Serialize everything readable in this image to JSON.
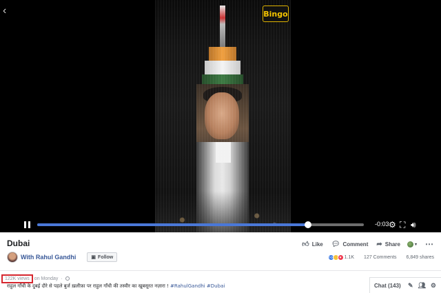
{
  "player": {
    "watermark": "Bingo",
    "time_remaining": "-0:03",
    "progress_fraction": 0.83
  },
  "post": {
    "title": "Dubai",
    "actions": {
      "like": "Like",
      "comment": "Comment",
      "share": "Share"
    },
    "page_name": "With Rahul Gandhi",
    "follow_label": "Follow",
    "reactions_count": "1.1K",
    "comments_count": "127 Comments",
    "shares_count": "6,849 shares",
    "views": "122K views",
    "posted": "on Monday",
    "caption": "राहुल गाँधी के दुबई दौरे से पहले बुर्ज ख़लीफ़ा पर राहुल गाँधी की तस्वीर का खूबसूरत नज़ारा !",
    "hashtags": "#RahulGandhi #Dubai"
  },
  "chat": {
    "label": "Chat (143)"
  },
  "icons": [
    "back-arrow-icon",
    "pause-icon",
    "settings-gear-icon",
    "fullscreen-icon",
    "volume-icon",
    "like-icon",
    "comment-icon",
    "share-icon",
    "globe-icon",
    "more-icon",
    "follow-icon",
    "public-icon",
    "compose-icon",
    "contacts-icon",
    "chat-settings-icon"
  ]
}
